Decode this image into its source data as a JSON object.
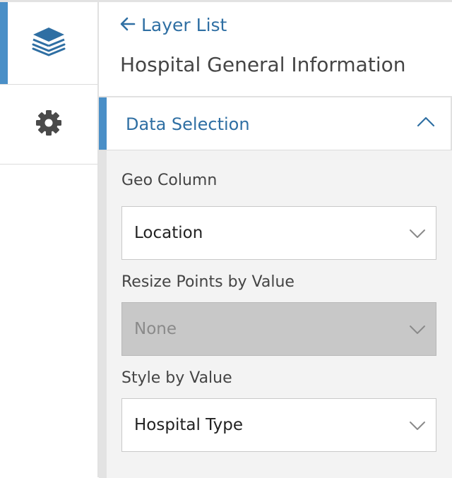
{
  "rail": {
    "items": [
      {
        "icon": "layers-icon",
        "active": true
      },
      {
        "icon": "gear-icon",
        "active": false
      }
    ]
  },
  "panel": {
    "back_label": "Layer List",
    "layer_title": "Hospital General Information",
    "section": {
      "title": "Data Selection",
      "expanded": true,
      "fields": [
        {
          "label": "Geo Column",
          "value": "Location",
          "disabled": false
        },
        {
          "label": "Resize Points by Value",
          "value": "None",
          "disabled": true
        },
        {
          "label": "Style by Value",
          "value": "Hospital Type",
          "disabled": false
        }
      ]
    }
  },
  "colors": {
    "accent": "#4a8fc7",
    "link": "#2f6fa3",
    "icon": "#4a4a4a",
    "section_bg": "#f3f3f3",
    "disabled_bg": "#c8c8c8"
  }
}
